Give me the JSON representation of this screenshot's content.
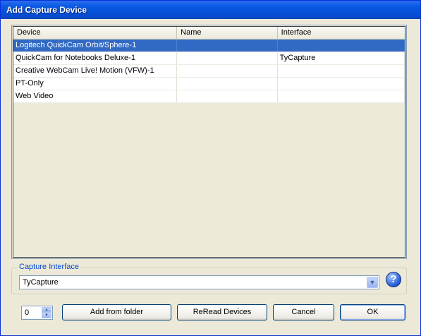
{
  "window": {
    "title": "Add Capture Device"
  },
  "listview": {
    "columns": [
      "Device",
      "Name",
      "Interface"
    ],
    "rows": [
      {
        "device": "Logitech QuickCam Orbit/Sphere-1",
        "name": "",
        "interface": "",
        "selected": true
      },
      {
        "device": "QuickCam for Notebooks Deluxe-1",
        "name": "",
        "interface": "TyCapture",
        "selected": false
      },
      {
        "device": "Creative WebCam Live! Motion (VFW)-1",
        "name": "",
        "interface": "",
        "selected": false
      },
      {
        "device": "PT-Only",
        "name": "",
        "interface": "",
        "selected": false
      },
      {
        "device": "Web Video",
        "name": "",
        "interface": "",
        "selected": false
      }
    ]
  },
  "capture_interface": {
    "label": "Capture Interface",
    "selected": "TyCapture"
  },
  "footer": {
    "spinner_value": "0",
    "add_from_folder": "Add from folder",
    "reread_devices": "ReRead Devices",
    "cancel": "Cancel",
    "ok": "OK"
  },
  "icons": {
    "help": "help-icon",
    "dropdown": "chevron-down-icon"
  },
  "colors": {
    "selection": "#316ac5",
    "title_bar": "#0a5ae3",
    "group_label": "#0046d5"
  }
}
